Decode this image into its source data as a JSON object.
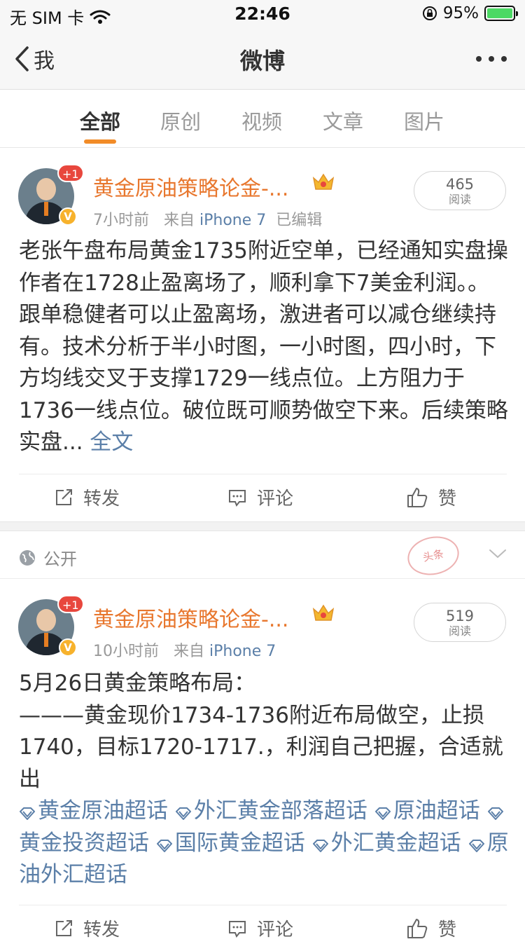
{
  "status_bar": {
    "carrier": "无 SIM 卡",
    "time": "22:46",
    "battery": "95%"
  },
  "nav": {
    "back_label": "我",
    "title": "微博"
  },
  "tabs": [
    {
      "label": "全部",
      "active": true
    },
    {
      "label": "原创",
      "active": false
    },
    {
      "label": "视频",
      "active": false
    },
    {
      "label": "文章",
      "active": false
    },
    {
      "label": "图片",
      "active": false
    }
  ],
  "accent_color": "#f28c28",
  "link_color": "#5b7fa8",
  "posts": [
    {
      "avatar_badge": "+1",
      "username": "黄金原油策略论金-...",
      "time": "7小时前",
      "from_label": "来自",
      "source": "iPhone 7",
      "edited": "已编辑",
      "reads": "465",
      "reads_label": "阅读",
      "body": "老张午盘布局黄金1735附近空单，已经通知实盘操作者在1728止盈离场了，顺利拿下7美金利润。。跟单稳健者可以止盈离场，激进者可以减仓继续持有。技术分析于半小时图，一小时图，四小时，下方均线交叉于支撑1729一线点位。上方阻力于1736一线点位。破位既可顺势做空下来。后续策略实盘...",
      "more_link": "全文",
      "actions": {
        "repost": "转发",
        "comment": "评论",
        "like": "赞"
      }
    },
    {
      "avatar_badge": "+1",
      "username": "黄金原油策略论金-...",
      "time": "10小时前",
      "from_label": "来自",
      "source": "iPhone 7",
      "reads": "519",
      "reads_label": "阅读",
      "body_line1": "5月26日黄金策略布局：",
      "body_line2": "———黄金现价1734-1736附近布局做空，止损1740，目标1720-1717.，利润自己把握，合适就出",
      "topics": [
        "黄金原油超话",
        "外汇黄金部落超话",
        "原油超话",
        "黄金投资超话",
        "国际黄金超话",
        "外汇黄金超话",
        "原油外汇超话"
      ],
      "actions": {
        "repost": "转发",
        "comment": "评论",
        "like": "赞"
      }
    }
  ],
  "visibility": {
    "label": "公开",
    "stamp_text": "头条"
  }
}
